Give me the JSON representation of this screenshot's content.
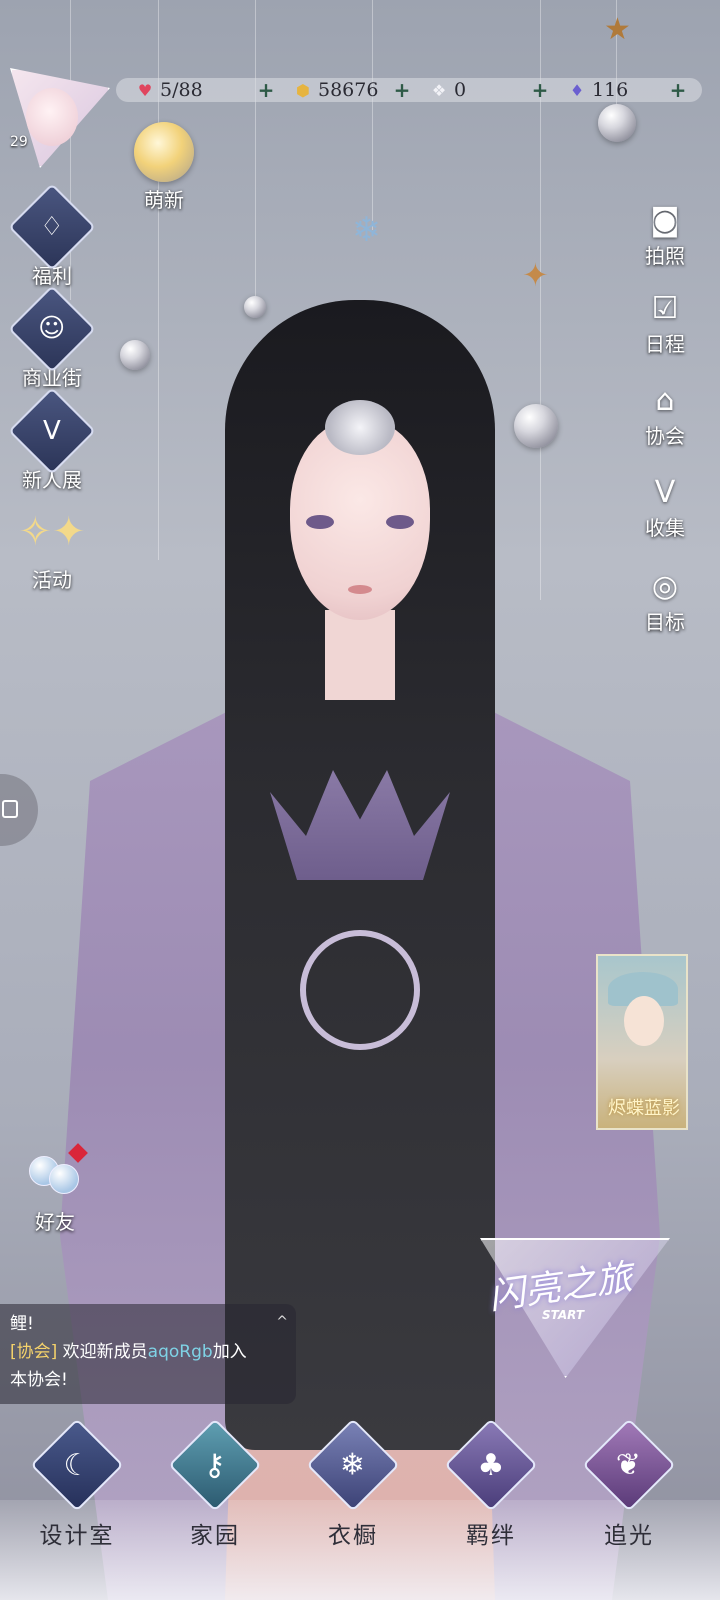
{
  "player": {
    "level": "29"
  },
  "resources": {
    "stamina": {
      "icon": "heart-icon",
      "value": "5/88"
    },
    "coins": {
      "icon": "coin-icon",
      "value": "58676"
    },
    "crystal": {
      "icon": "crystal-icon",
      "value": "0"
    },
    "diamonds": {
      "icon": "diamond-icon",
      "value": "116"
    }
  },
  "left_menu": {
    "newbie": "萌新",
    "welfare": "福利",
    "shop_street": "商业街",
    "new_exhibit": "新人展",
    "events": "活动"
  },
  "right_menu": {
    "photo": "拍照",
    "schedule": "日程",
    "guild": "协会",
    "collection": "收集",
    "goals": "目标"
  },
  "promo": {
    "text": "烬蝶蓝影"
  },
  "friends": {
    "label": "好友"
  },
  "chat": {
    "line1": "鲤!",
    "tag": "[协会]",
    "welcome": "欢迎新成员",
    "member": "aqoRgb",
    "joined": "加入",
    "line3": "本协会!",
    "collapse": "^"
  },
  "journey": {
    "title": "闪亮之旅",
    "start": "START"
  },
  "dock": {
    "items": [
      {
        "label": "设计室",
        "icon": "moon-icon"
      },
      {
        "label": "家园",
        "icon": "key-icon"
      },
      {
        "label": "衣橱",
        "icon": "snowflake-icon"
      },
      {
        "label": "羁绊",
        "icon": "clover-icon"
      },
      {
        "label": "追光",
        "icon": "butterfly-icon"
      }
    ]
  },
  "colors": {
    "accent": "#2e5a47",
    "chat_tag": "#f4d26b",
    "chat_name": "#7fd3e6",
    "badge_red": "#d9263a"
  }
}
